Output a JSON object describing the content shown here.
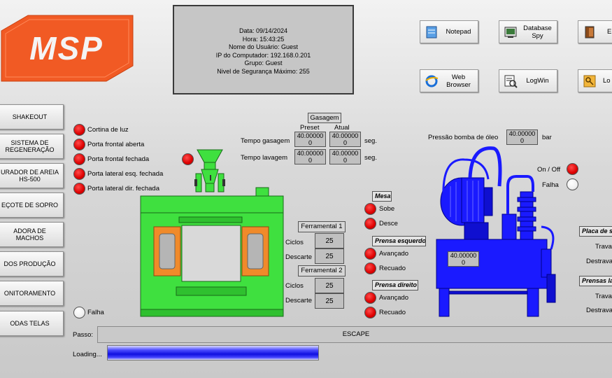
{
  "logo": {
    "text": "MSP"
  },
  "info": {
    "lines": [
      "Data: 09/14/2024",
      "Hora: 15:43:25",
      "Nome do Usuário: Guest",
      "IP do Computador: 192.168.0.201",
      "Grupo: Guest",
      "Nivel de Segurança Máximo: 255"
    ]
  },
  "top_buttons": {
    "notepad": "Notepad",
    "database_spy_1": "Database",
    "database_spy_2": "Spy",
    "exit_partial": "E",
    "web_browser_1": "Web",
    "web_browser_2": "Browser",
    "logwin": "LogWin",
    "login_partial": "Lo"
  },
  "menu": [
    "SHAKEOUT",
    "SISTEMA DE REGENERAÇÃO",
    "URADOR DE AREIA HS-500",
    "EÇOTE DE SOPRO",
    "ADORA DE MACHOS",
    "DOS PRODUÇÃO",
    "ONITORAMENTO",
    "ODAS TELAS"
  ],
  "doors": [
    "Cortina de luz",
    "Porta frontal aberta",
    "Porta frontal fechada",
    "Porta lateral esq. fechada",
    "Porta lateral dir. fechada"
  ],
  "falha_left": "Falha",
  "gasagem": {
    "title": "Gasagem",
    "col_preset": "Preset",
    "col_atual": "Atual",
    "rows": [
      {
        "label": "Tempo gasagem",
        "preset": "40.00000",
        "preset_sub": "0",
        "atual": "40.00000",
        "atual_sub": "0",
        "unit": "seg."
      },
      {
        "label": "Tempo lavagem",
        "preset": "40.00000",
        "preset_sub": "0",
        "atual": "40.00000",
        "atual_sub": "0",
        "unit": "seg."
      }
    ]
  },
  "ferramental1": {
    "title": "Ferramental 1",
    "ciclos_label": "Ciclos",
    "ciclos": "25",
    "descarte_label": "Descarte",
    "descarte": "25"
  },
  "ferramental2": {
    "title": "Ferramental 2",
    "ciclos_label": "Ciclos",
    "ciclos": "25",
    "descarte_label": "Descarte",
    "descarte": "25"
  },
  "mesa": {
    "title": "Mesa",
    "sobe": "Sobe",
    "desce": "Desce"
  },
  "prensa_esq": {
    "title": "Prensa esquerdo",
    "avancado": "Avançado",
    "recuado": "Recuado"
  },
  "prensa_dir": {
    "title": "Prensa direito",
    "avancado": "Avançado",
    "recuado": "Recuado"
  },
  "pressao": {
    "label": "Pressão bomba de óleo",
    "value": "40.00000",
    "sub": "0",
    "unit": "bar"
  },
  "hydraulic": {
    "on_off": "On / Off",
    "falha": "Falha",
    "tank_value": "40.00000",
    "tank_sub": "0"
  },
  "right_panel": {
    "placa_title": "Placa de s",
    "placa_trava": "Trava",
    "placa_destrava": "Destrava",
    "prensas_title": "Prensas la",
    "prensas_trava": "Trava",
    "prensas_destrava": "Destrava"
  },
  "passo": {
    "label": "Passo:",
    "value": "ESCAPE"
  },
  "loading": {
    "label": "Loading..."
  },
  "colors": {
    "accent_logo": "#f15a24",
    "machine_green": "#39e639",
    "hydraulic_blue": "#1a1aff",
    "led_red": "#dd0000"
  }
}
